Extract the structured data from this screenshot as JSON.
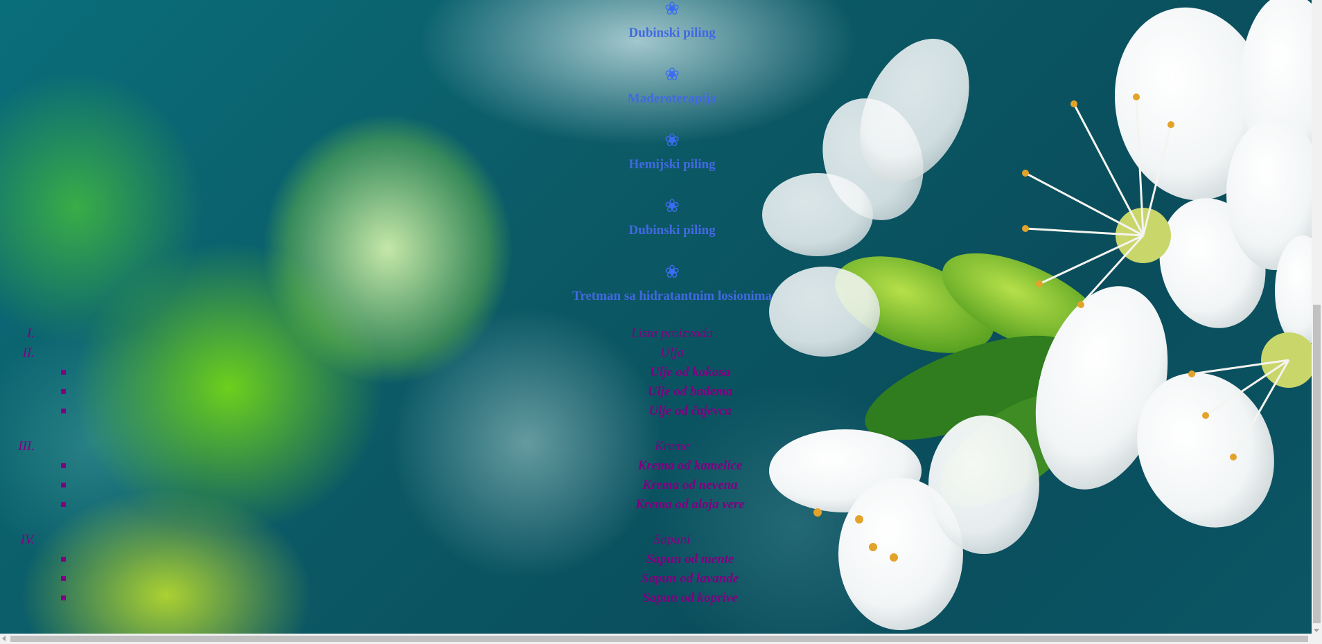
{
  "treatments": [
    {
      "icon": "flower-icon",
      "label": "Dubinski piling"
    },
    {
      "icon": "flower-icon",
      "label": "Maderoterapija"
    },
    {
      "icon": "flower-icon",
      "label": "Hemijski piling"
    },
    {
      "icon": "flower-icon",
      "label": "Dubinski piling"
    },
    {
      "icon": "flower-icon",
      "label": "Tretman sa hidratantnim losionima"
    }
  ],
  "flower_glyph": "❀",
  "products": {
    "items": [
      {
        "numeral": "I.",
        "label": "Lista proizvoda"
      },
      {
        "numeral": "II.",
        "label": "Ulja",
        "subitems": [
          "Ulje od kokosa",
          "Ulje od badema",
          "Ulje od čajevca"
        ]
      },
      {
        "numeral": "III.",
        "label": "Kreme",
        "subitems": [
          "Krema od kamelice",
          "Krema od nevena",
          "Krema od aloja vere"
        ]
      },
      {
        "numeral": "IV.",
        "label": "Sapuni",
        "subitems": [
          "Sapun od mente",
          "Sapun od lavande",
          "Sapun od koprive"
        ]
      }
    ]
  },
  "colors": {
    "treatment_text": "#4169e1",
    "product_text": "#800080"
  }
}
